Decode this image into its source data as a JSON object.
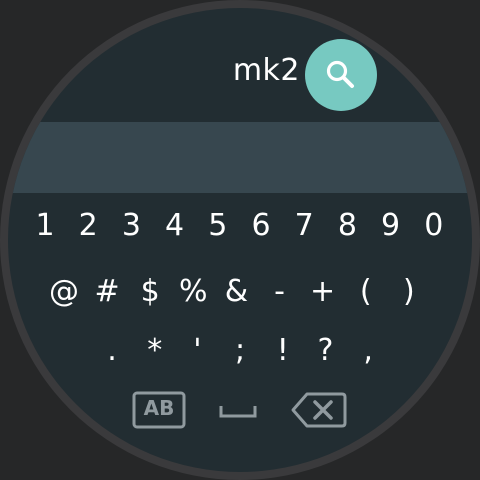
{
  "search": {
    "query": "mk2",
    "button_icon": "search-icon"
  },
  "keyboard": {
    "row1": [
      "1",
      "2",
      "3",
      "4",
      "5",
      "6",
      "7",
      "8",
      "9",
      "0"
    ],
    "row2": [
      "@",
      "#",
      "$",
      "%",
      "&",
      "-",
      "+",
      "(",
      ")"
    ],
    "row3": [
      ".",
      "*",
      "'",
      ";",
      "!",
      "?",
      ","
    ],
    "function_keys": {
      "mode_label": "AB",
      "space_icon": "space-bar-icon",
      "backspace_icon": "backspace-icon"
    }
  },
  "colors": {
    "face_background": "#222d32",
    "result_bar": "#37474f",
    "search_button": "#77c9c1",
    "bezel": "#3a3a3c",
    "outer_background": "#262728",
    "key_text": "#ffffff",
    "function_key": "#909a9f"
  }
}
